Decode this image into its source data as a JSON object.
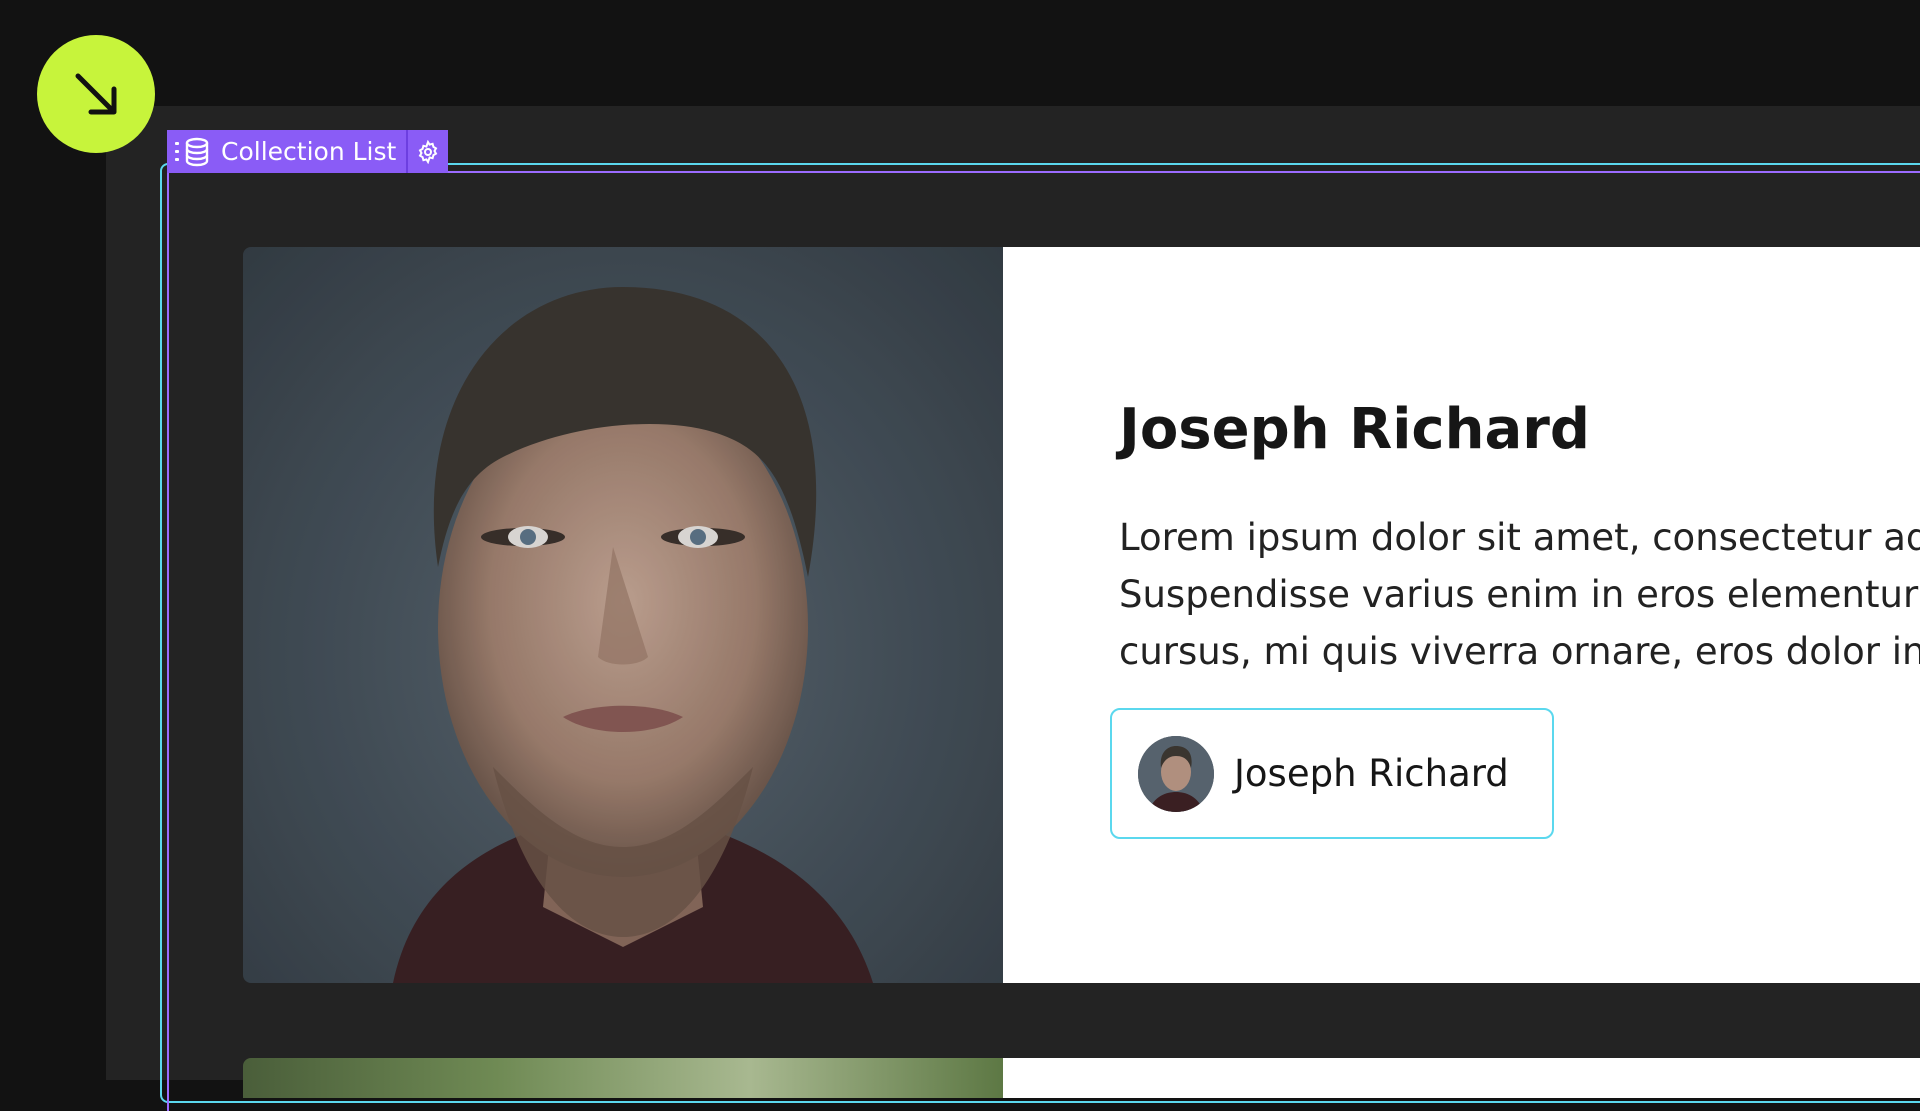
{
  "tag": {
    "label": "Collection List",
    "icon": "database-list-icon",
    "settings_icon": "gear-icon",
    "color": "#8a5cf6"
  },
  "cursor_badge": {
    "icon": "arrow-down-right-icon",
    "color": "#c7f43b"
  },
  "selection_color": "#5bd8ee",
  "card": {
    "title": "Joseph Richard",
    "body_lines": [
      "Lorem ipsum dolor sit amet, consectetur ad",
      "Suspendisse varius enim in eros elementur",
      "cursus, mi quis viverra ornare, eros dolor in"
    ],
    "author_name": "Joseph Richard",
    "photo": "portrait-photo",
    "avatar": "author-avatar"
  }
}
